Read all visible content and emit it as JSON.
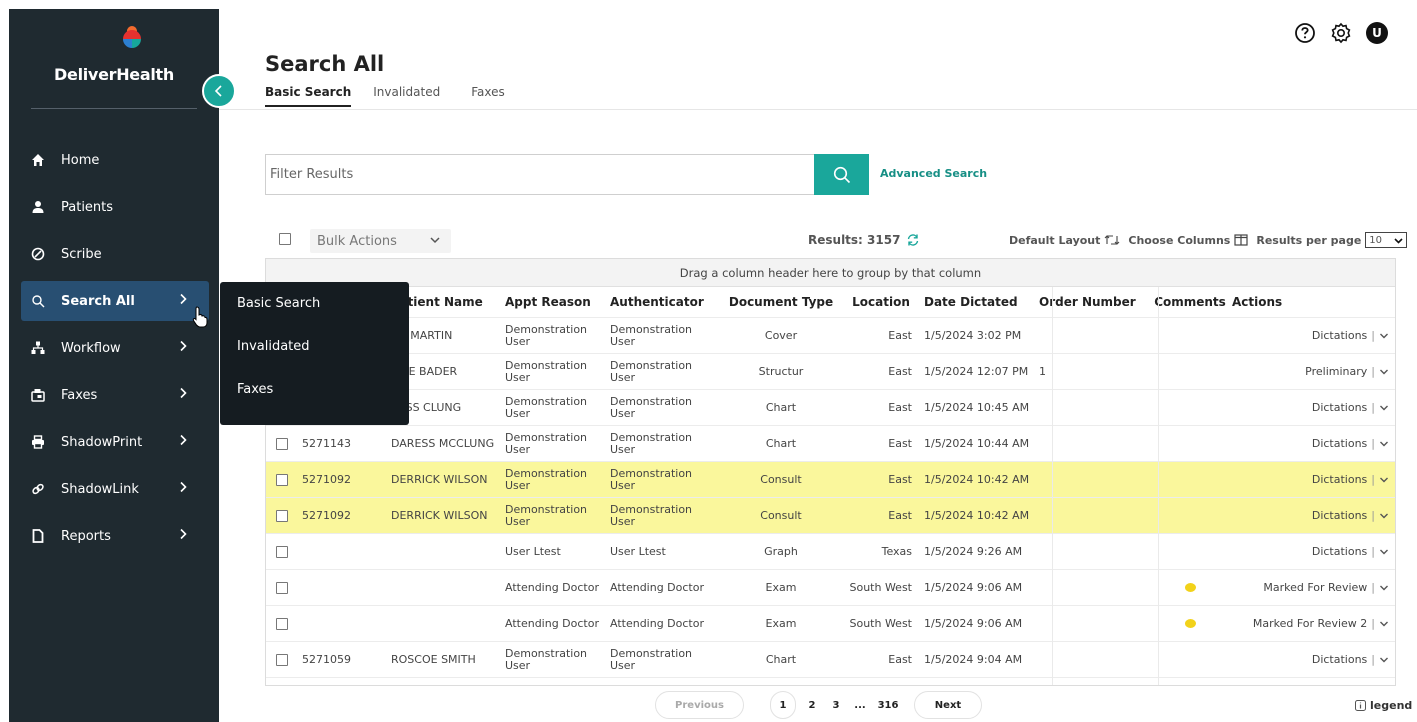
{
  "brand": {
    "name": "DeliverHealth"
  },
  "sidebar": {
    "items": [
      {
        "label": "Home",
        "icon": "home-icon"
      },
      {
        "label": "Patients",
        "icon": "user-icon"
      },
      {
        "label": "Scribe",
        "icon": "scribe-icon"
      },
      {
        "label": "Search All",
        "icon": "search-icon"
      },
      {
        "label": "Workflow",
        "icon": "workflow-icon"
      },
      {
        "label": "Faxes",
        "icon": "fax-icon"
      },
      {
        "label": "ShadowPrint",
        "icon": "printer-icon"
      },
      {
        "label": "ShadowLink",
        "icon": "link-icon"
      },
      {
        "label": "Reports",
        "icon": "document-icon"
      }
    ],
    "active": "Search All"
  },
  "flyout": {
    "items": [
      "Basic Search",
      "Invalidated",
      "Faxes"
    ]
  },
  "header": {
    "title": "Search All",
    "tabs": [
      "Basic Search",
      "Invalidated",
      "Faxes"
    ],
    "active_tab": "Basic Search",
    "avatar_initial": "U"
  },
  "search": {
    "placeholder": "Filter Results",
    "advanced_label": "Advanced Search"
  },
  "toolbar": {
    "bulk_actions": "Bulk Actions",
    "results_label": "Results: 3157",
    "default_layout": "Default Layout",
    "choose_columns": "Choose Columns",
    "results_per_page": "Results per page",
    "per_page_value": "10"
  },
  "grid": {
    "group_hint": "Drag a column header here to group by that column",
    "columns": [
      "",
      "Patient Name",
      "Appt Reason",
      "Authenticator",
      "Document Type",
      "Location",
      "Date Dictated",
      "Order Number",
      "Comments",
      "Actions"
    ],
    "rows": [
      {
        "id": "",
        "patient": "NA MARTIN",
        "reason": "Demonstration User",
        "auth": "Demonstration User",
        "doctype": "Cover",
        "location": "East",
        "date": "1/5/2024 3:02 PM",
        "order": "",
        "comment": false,
        "action": "Dictations",
        "highlight": false
      },
      {
        "id": "",
        "patient": "LINE BADER",
        "reason": "Demonstration User",
        "auth": "Demonstration User",
        "doctype": "Structur",
        "location": "East",
        "date": "1/5/2024 12:07 PM",
        "order": "1",
        "comment": false,
        "action": "Preliminary",
        "highlight": false
      },
      {
        "id": "",
        "patient": "RESS CLUNG",
        "reason": "Demonstration User",
        "auth": "Demonstration User",
        "doctype": "Chart",
        "location": "East",
        "date": "1/5/2024 10:45 AM",
        "order": "",
        "comment": false,
        "action": "Dictations",
        "highlight": false
      },
      {
        "id": "5271143",
        "patient": "DARESS MCCLUNG",
        "reason": "Demonstration User",
        "auth": "Demonstration User",
        "doctype": "Chart",
        "location": "East",
        "date": "1/5/2024 10:44 AM",
        "order": "",
        "comment": false,
        "action": "Dictations",
        "highlight": false
      },
      {
        "id": "5271092",
        "patient": "DERRICK WILSON",
        "reason": "Demonstration User",
        "auth": "Demonstration User",
        "doctype": "Consult",
        "location": "East",
        "date": "1/5/2024 10:42 AM",
        "order": "",
        "comment": false,
        "action": "Dictations",
        "highlight": true
      },
      {
        "id": "5271092",
        "patient": "DERRICK WILSON",
        "reason": "Demonstration User",
        "auth": "Demonstration User",
        "doctype": "Consult",
        "location": "East",
        "date": "1/5/2024 10:42 AM",
        "order": "",
        "comment": false,
        "action": "Dictations",
        "highlight": true
      },
      {
        "id": "",
        "patient": "",
        "reason": "User Ltest",
        "auth": "User Ltest",
        "doctype": "Graph",
        "location": "Texas",
        "date": "1/5/2024 9:26 AM",
        "order": "",
        "comment": false,
        "action": "Dictations",
        "highlight": false
      },
      {
        "id": "",
        "patient": "",
        "reason": "Attending Doctor",
        "auth": "Attending Doctor",
        "doctype": "Exam",
        "location": "South West",
        "date": "1/5/2024 9:06 AM",
        "order": "",
        "comment": true,
        "action": "Marked For Review",
        "highlight": false
      },
      {
        "id": "",
        "patient": "",
        "reason": "Attending Doctor",
        "auth": "Attending Doctor",
        "doctype": "Exam",
        "location": "South West",
        "date": "1/5/2024 9:06 AM",
        "order": "",
        "comment": true,
        "action": "Marked For Review 2",
        "highlight": false
      },
      {
        "id": "5271059",
        "patient": "ROSCOE SMITH",
        "reason": "Demonstration User",
        "auth": "Demonstration User",
        "doctype": "Chart",
        "location": "East",
        "date": "1/5/2024 9:04 AM",
        "order": "",
        "comment": false,
        "action": "Dictations",
        "highlight": false
      }
    ]
  },
  "pagination": {
    "previous": "Previous",
    "pages": [
      "1",
      "2",
      "3",
      "...",
      "316"
    ],
    "current": "1",
    "next": "Next"
  },
  "legend_label": "legend",
  "colors": {
    "sidebar_bg": "#1f2a30",
    "accent": "#1aa79b",
    "active_nav": "#284f72",
    "highlight_row": "#faf79c"
  }
}
